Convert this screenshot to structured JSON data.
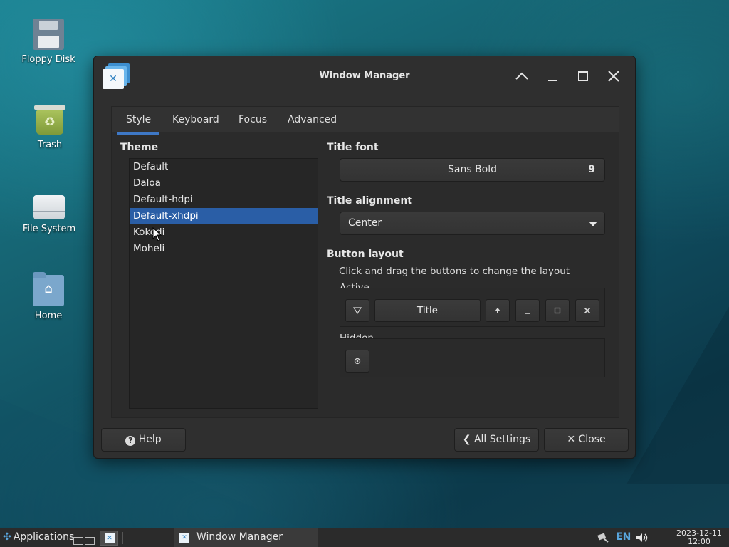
{
  "desktop": {
    "icons": [
      {
        "label": "Floppy Disk"
      },
      {
        "label": "Trash"
      },
      {
        "label": "File System"
      },
      {
        "label": "Home"
      }
    ]
  },
  "window": {
    "title": "Window Manager",
    "tabs": [
      {
        "label": "Style",
        "active": true
      },
      {
        "label": "Keyboard"
      },
      {
        "label": "Focus"
      },
      {
        "label": "Advanced"
      }
    ],
    "theme": {
      "heading": "Theme",
      "items": [
        "Default",
        "Daloa",
        "Default-hdpi",
        "Default-xhdpi",
        "Kokodi",
        "Moheli"
      ],
      "selected": "Default-xhdpi"
    },
    "title_font": {
      "heading": "Title font",
      "font_name": "Sans Bold",
      "font_size": "9"
    },
    "title_alignment": {
      "heading": "Title alignment",
      "value": "Center"
    },
    "button_layout": {
      "heading": "Button layout",
      "hint": "Click and drag the buttons to change the layout",
      "active_label": "Active",
      "title_button": "Title",
      "hidden_label": "Hidden"
    },
    "buttons": {
      "help": "Help",
      "all_settings": "All Settings",
      "close": "Close"
    }
  },
  "taskbar": {
    "applications": "Applications",
    "window_button": "Window Manager",
    "language": "EN",
    "clock_date": "2023-12-11",
    "clock_time": "12:00"
  },
  "colors": {
    "selection": "#2a5ea6",
    "tab_underline": "#3e78c6",
    "window_bg": "#2f2f2f"
  }
}
